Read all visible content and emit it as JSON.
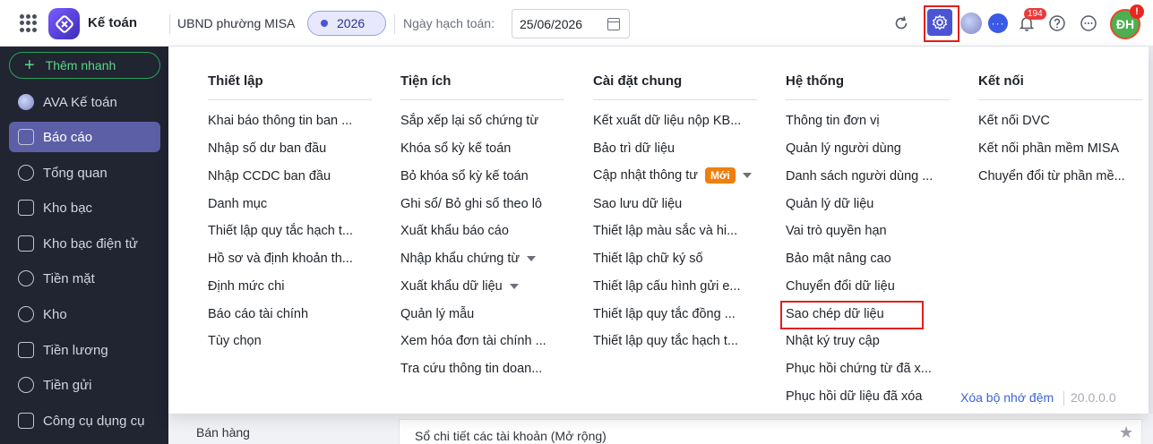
{
  "header": {
    "app_title": "Kế toán",
    "org_name": "UBND phường MISA",
    "year": "2026",
    "date_label": "Ngày hạch toán:",
    "date_value": "25/06/2026",
    "notification_count": "194",
    "avatar_initials": "ĐH",
    "avatar_alert": "!"
  },
  "sidebar": {
    "quick_add": "Thêm nhanh",
    "items": [
      {
        "label": "AVA Kế toán"
      },
      {
        "label": "Báo cáo"
      },
      {
        "label": "Tổng quan"
      },
      {
        "label": "Kho bạc"
      },
      {
        "label": "Kho bạc điện tử"
      },
      {
        "label": "Tiền mặt"
      },
      {
        "label": "Kho"
      },
      {
        "label": "Tiền lương"
      },
      {
        "label": "Tiền gửi"
      },
      {
        "label": "Công cụ dụng cụ"
      }
    ],
    "active_index": 1
  },
  "dropdown": {
    "columns": [
      {
        "title": "Thiết lập",
        "items": [
          {
            "label": "Khai báo thông tin ban ..."
          },
          {
            "label": "Nhập số dư ban đầu"
          },
          {
            "label": "Nhập CCDC ban đầu"
          },
          {
            "label": "Danh mục"
          },
          {
            "label": "Thiết lập quy tắc hạch t..."
          },
          {
            "label": "Hồ sơ và định khoản th..."
          },
          {
            "label": "Định mức chi"
          },
          {
            "label": "Báo cáo tài chính"
          },
          {
            "label": "Tùy chọn"
          }
        ]
      },
      {
        "title": "Tiện ích",
        "items": [
          {
            "label": "Sắp xếp lại số chứng từ"
          },
          {
            "label": "Khóa sổ kỳ kế toán"
          },
          {
            "label": "Bỏ khóa sổ kỳ kế toán"
          },
          {
            "label": "Ghi sổ/ Bỏ ghi sổ theo lô"
          },
          {
            "label": "Xuất khẩu báo cáo"
          },
          {
            "label": "Nhập khẩu chứng từ"
          },
          {
            "label": "Xuất khẩu dữ liệu"
          },
          {
            "label": "Quản lý mẫu"
          },
          {
            "label": "Xem hóa đơn tài chính ..."
          },
          {
            "label": "Tra cứu thông tin doan..."
          }
        ]
      },
      {
        "title": "Cài đặt chung",
        "items": [
          {
            "label": "Kết xuất dữ liệu nộp KB..."
          },
          {
            "label": "Bảo trì dữ liệu"
          },
          {
            "label": "Cập nhật thông tư",
            "badge": "Mới"
          },
          {
            "label": "Sao lưu dữ liệu"
          },
          {
            "label": "Thiết lập màu sắc và hi..."
          },
          {
            "label": "Thiết lập chữ ký số"
          },
          {
            "label": "Thiết lập cấu hình gửi e..."
          },
          {
            "label": "Thiết lập quy tắc đồng ..."
          },
          {
            "label": "Thiết lập quy tắc hạch t..."
          }
        ]
      },
      {
        "title": "Hệ thống",
        "items": [
          {
            "label": "Thông tin đơn vị"
          },
          {
            "label": "Quản lý người dùng"
          },
          {
            "label": "Danh sách người dùng ..."
          },
          {
            "label": "Quản lý dữ liệu"
          },
          {
            "label": "Vai trò quyền hạn"
          },
          {
            "label": "Bảo mật nâng cao"
          },
          {
            "label": "Chuyển đổi dữ liệu"
          },
          {
            "label": "Sao chép dữ liệu"
          },
          {
            "label": "Nhật ký truy cập"
          },
          {
            "label": "Phục hồi chứng từ đã x..."
          },
          {
            "label": "Phục hồi dữ liệu đã xóa"
          }
        ]
      },
      {
        "title": "Kết nối",
        "items": [
          {
            "label": "Kết nối DVC"
          },
          {
            "label": "Kết nối phần mềm MISA"
          },
          {
            "label": "Chuyển đổi từ phần mề..."
          }
        ]
      }
    ],
    "footer": {
      "clear_cache": "Xóa bộ nhớ đệm",
      "version": "20.0.0.0"
    }
  },
  "background": {
    "left_item": "Bán hàng",
    "right_item": "Sổ chi tiết các tài khoản (Mở rộng)"
  },
  "colors": {
    "accent": "#4c54d6",
    "sidebar_bg": "#212431",
    "highlight": "#e0201c",
    "new_badge": "#f07f0b"
  }
}
